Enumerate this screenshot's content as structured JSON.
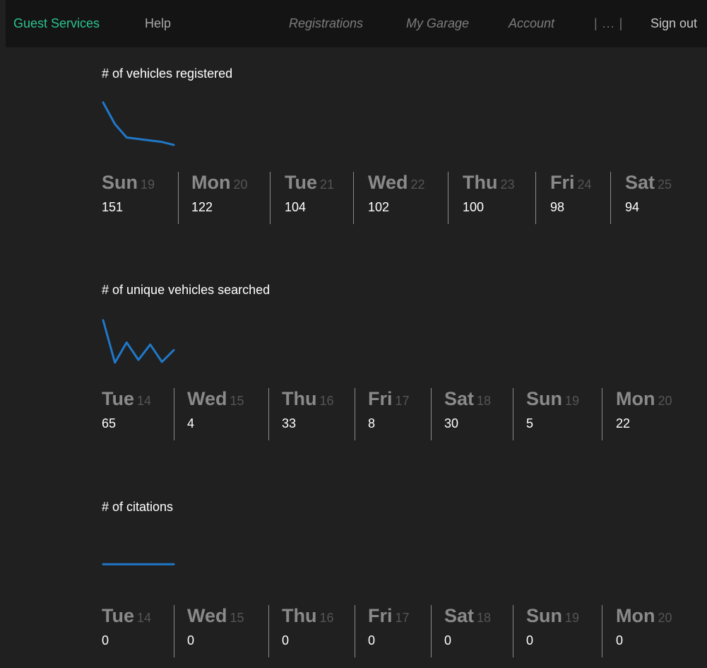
{
  "nav": {
    "brand": "Guest Services",
    "help": "Help",
    "registrations": "Registrations",
    "my_garage": "My Garage",
    "account": "Account",
    "pipe": "| ... |",
    "sign_out": "Sign out"
  },
  "colors": {
    "background": "#202020",
    "topbar": "#141414",
    "brand": "#2bc48f",
    "sparkline": "#1f78c8"
  },
  "sections": [
    {
      "title": "# of vehicles registered",
      "days": [
        {
          "name": "Sun",
          "date": "19",
          "value": "151"
        },
        {
          "name": "Mon",
          "date": "20",
          "value": "122"
        },
        {
          "name": "Tue",
          "date": "21",
          "value": "104"
        },
        {
          "name": "Wed",
          "date": "22",
          "value": "102"
        },
        {
          "name": "Thu",
          "date": "23",
          "value": "100"
        },
        {
          "name": "Fri",
          "date": "24",
          "value": "98"
        },
        {
          "name": "Sat",
          "date": "25",
          "value": "94"
        }
      ]
    },
    {
      "title": "# of unique vehicles searched",
      "days": [
        {
          "name": "Tue",
          "date": "14",
          "value": "65"
        },
        {
          "name": "Wed",
          "date": "15",
          "value": "4"
        },
        {
          "name": "Thu",
          "date": "16",
          "value": "33"
        },
        {
          "name": "Fri",
          "date": "17",
          "value": "8"
        },
        {
          "name": "Sat",
          "date": "18",
          "value": "30"
        },
        {
          "name": "Sun",
          "date": "19",
          "value": "5"
        },
        {
          "name": "Mon",
          "date": "20",
          "value": "22"
        }
      ]
    },
    {
      "title": "# of citations",
      "days": [
        {
          "name": "Tue",
          "date": "14",
          "value": "0"
        },
        {
          "name": "Wed",
          "date": "15",
          "value": "0"
        },
        {
          "name": "Thu",
          "date": "16",
          "value": "0"
        },
        {
          "name": "Fri",
          "date": "17",
          "value": "0"
        },
        {
          "name": "Sat",
          "date": "18",
          "value": "0"
        },
        {
          "name": "Sun",
          "date": "19",
          "value": "0"
        },
        {
          "name": "Mon",
          "date": "20",
          "value": "0"
        }
      ]
    }
  ],
  "chart_data": [
    {
      "type": "line",
      "title": "# of vehicles registered",
      "categories": [
        "Sun 19",
        "Mon 20",
        "Tue 21",
        "Wed 22",
        "Thu 23",
        "Fri 24",
        "Sat 25"
      ],
      "values": [
        151,
        122,
        104,
        102,
        100,
        98,
        94
      ],
      "grid": false,
      "xlabel": "",
      "ylabel": ""
    },
    {
      "type": "line",
      "title": "# of unique vehicles searched",
      "categories": [
        "Tue 14",
        "Wed 15",
        "Thu 16",
        "Fri 17",
        "Sat 18",
        "Sun 19",
        "Mon 20"
      ],
      "values": [
        65,
        4,
        33,
        8,
        30,
        5,
        22
      ],
      "grid": false,
      "xlabel": "",
      "ylabel": ""
    },
    {
      "type": "line",
      "title": "# of citations",
      "categories": [
        "Tue 14",
        "Wed 15",
        "Thu 16",
        "Fri 17",
        "Sat 18",
        "Sun 19",
        "Mon 20"
      ],
      "values": [
        0,
        0,
        0,
        0,
        0,
        0,
        0
      ],
      "grid": false,
      "xlabel": "",
      "ylabel": ""
    }
  ]
}
